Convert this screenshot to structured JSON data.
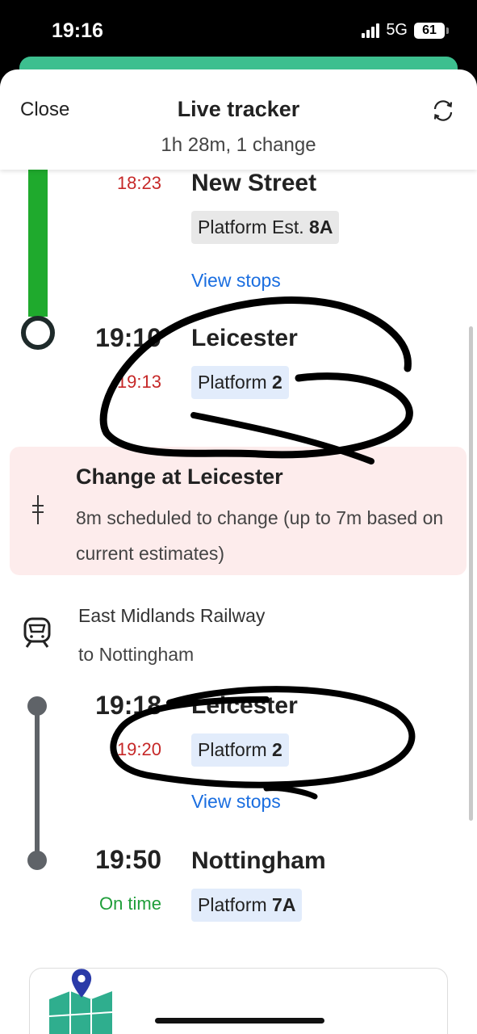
{
  "status_bar": {
    "time": "19:16",
    "network": "5G",
    "battery": "61"
  },
  "header": {
    "close_label": "Close",
    "title": "Live tracker",
    "subtitle": "1h 28m, 1 change"
  },
  "leg1": {
    "origin": {
      "estimated_time": "18:23",
      "station": "New Street",
      "platform_prefix": "Platform Est.",
      "platform": "8A"
    },
    "view_stops_label": "View stops",
    "destination": {
      "scheduled_time": "19:10",
      "estimated_time": "19:13",
      "station": "Leicester",
      "platform_prefix": "Platform",
      "platform": "2"
    }
  },
  "change": {
    "title": "Change at Leicester",
    "description": "8m scheduled to change (up to 7m based on current estimates)"
  },
  "leg2": {
    "operator": "East Midlands Railway",
    "destination_label": "to Nottingham",
    "origin": {
      "scheduled_time": "19:18",
      "estimated_time": "19:20",
      "station": "Leicester",
      "platform_prefix": "Platform",
      "platform": "2"
    },
    "view_stops_label": "View stops",
    "destination": {
      "scheduled_time": "19:50",
      "status": "On time",
      "station": "Nottingham",
      "platform_prefix": "Platform",
      "platform": "7A"
    }
  },
  "colors": {
    "route_green": "#1faa2d",
    "route_grey": "#5f6368",
    "accent_red": "#c62828",
    "link_blue": "#1a6ee0",
    "change_bg": "#fdecec"
  },
  "icons": [
    "refresh-icon",
    "interchange-icon",
    "train-icon",
    "map-icon",
    "location-pin-icon"
  ]
}
